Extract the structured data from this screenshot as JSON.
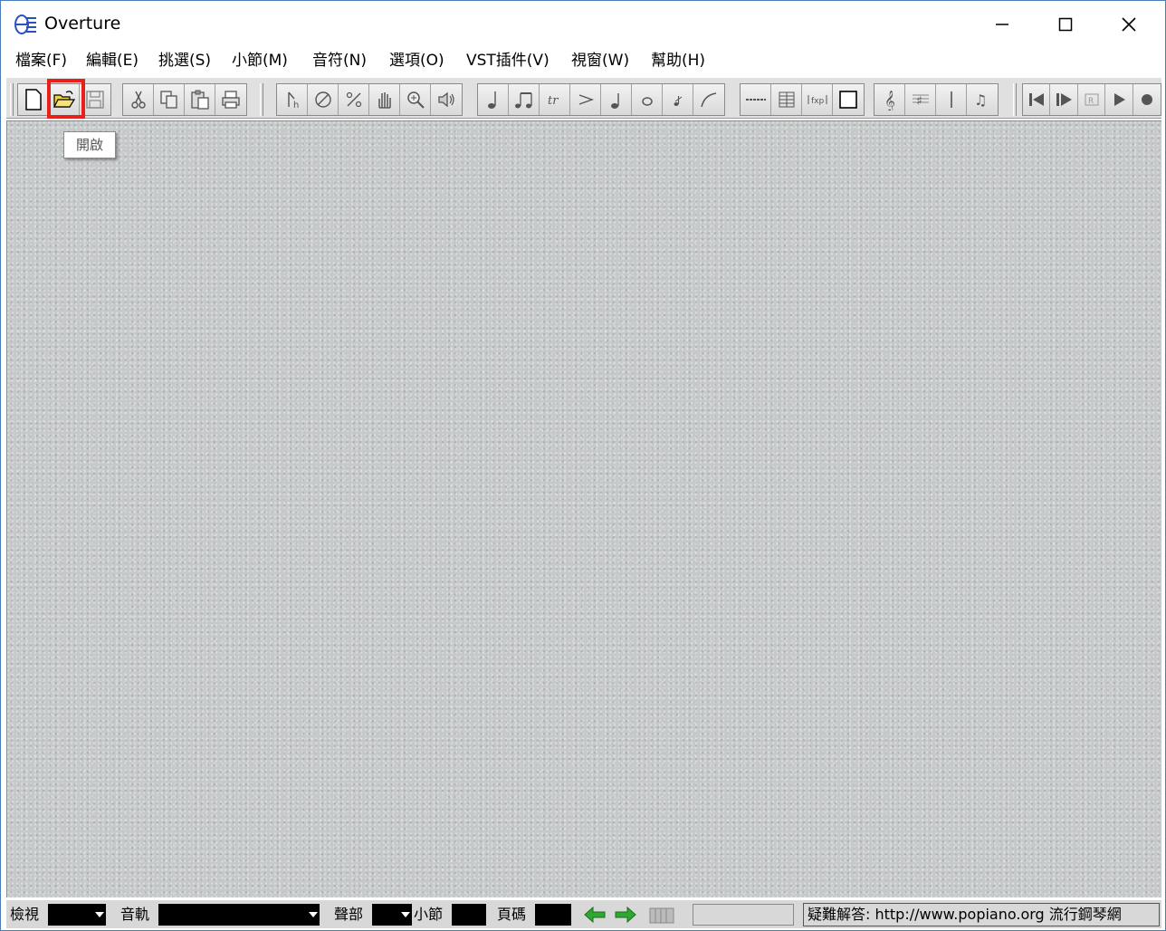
{
  "window": {
    "title": "Overture",
    "minimize_glyph": "—",
    "maximize_glyph": "☐",
    "close_glyph": "✕"
  },
  "menu": [
    {
      "label": "檔案(F)"
    },
    {
      "label": "編輯(E)"
    },
    {
      "label": "挑選(S)"
    },
    {
      "label": "小節(M)"
    },
    {
      "label": "音符(N)"
    },
    {
      "label": "選項(O)"
    },
    {
      "label": "VST插件(V)"
    },
    {
      "label": "視窗(W)"
    },
    {
      "label": "幫助(H)"
    }
  ],
  "toolbar": {
    "open_tooltip": "開啟",
    "highlight_color": "#e8201c"
  },
  "statusbar": {
    "view_label": "檢視",
    "track_label": "音軌",
    "voice_label": "聲部",
    "measure_label": "小節",
    "page_label": "頁碼",
    "message": "疑難解答: http://www.popiano.org 流行鋼琴網"
  },
  "colors": {
    "workspace": "#c6c9ca",
    "toolbar": "#e0e0e0",
    "arrow_green": "#2fa82f"
  }
}
